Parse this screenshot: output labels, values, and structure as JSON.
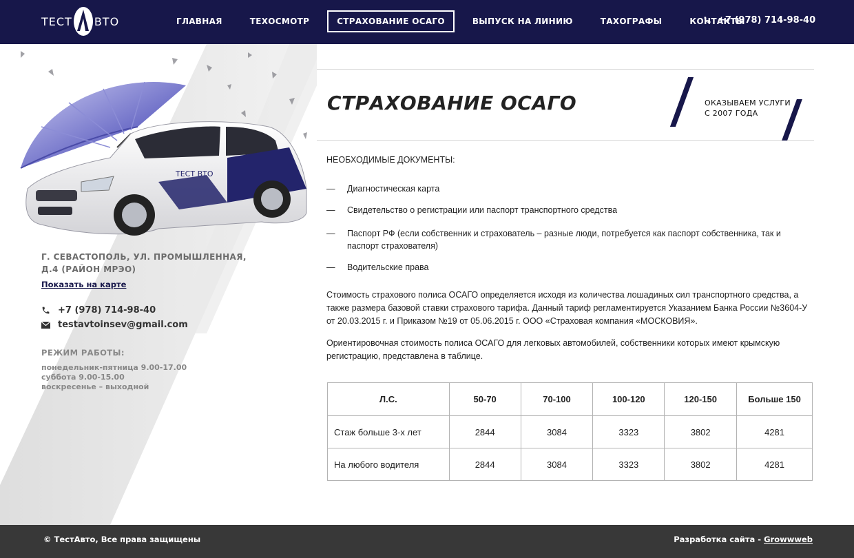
{
  "header": {
    "logo_left": "ТЕСТ",
    "logo_right": "ВТО",
    "nav": [
      {
        "label": "ГЛАВНАЯ"
      },
      {
        "label": "ТЕХОСМОТР"
      },
      {
        "label": "СТРАХОВАНИЕ ОСАГО"
      },
      {
        "label": "ВЫПУСК НА ЛИНИЮ"
      },
      {
        "label": "ТАХОГРАФЫ"
      },
      {
        "label": "КОНТАКТЫ"
      }
    ],
    "active_nav": "СТРАХОВАНИЕ ОСАГО",
    "phone": "+7 (978) 714-98-40"
  },
  "sidebar": {
    "hero_car_logo": "ТЕСТ ВТО",
    "address_line1": "г. Севастополь, ул. Промышленная,",
    "address_line2": "д.4 (район МРЭО)",
    "map_link": "Показать на карте",
    "phone": "+7 (978) 714-98-40",
    "email": "testavtoinsev@gmail.com",
    "hours_title": "РЕЖИМ РАБОТЫ:",
    "hours": [
      "понедельник-пятница 9.00-17.00",
      "суббота 9.00-15.00",
      "воскресенье – выходной"
    ]
  },
  "main": {
    "title": "СТРАХОВАНИЕ ОСАГО",
    "since_line1": "ОКАЗЫВАЕМ УСЛУГИ",
    "since_line2": "С 2007 ГОДА",
    "docs_title": "НЕОБХОДИМЫЕ ДОКУМЕНТЫ:",
    "dash": "—",
    "docs": [
      "Диагностическая карта",
      "Свидетельство о регистрации или паспорт транспортного средства",
      "Паспорт РФ (если собственник и страхователь – разные люди, потребуется как паспорт собственника, так и паспорт страхователя)",
      "Водительские права"
    ],
    "paragraph1": "Стоимость страхового полиса ОСАГО определяется исходя из количества лошадиных сил транспортного средства, а также размера базовой ставки страхового тарифа. Данный тариф регламентируется Указанием Банка России №3604-У от 20.03.2015 г. и Приказом №19 от 05.06.2015 г. ООО «Страховая компания «МОСКОВИЯ».",
    "paragraph2": "Ориентировочная стоимость полиса ОСАГО для легковых автомобилей, собственники которых имеют крымскую регистрацию, представлена в таблице.",
    "table": {
      "headers": [
        "Л.С.",
        "50-70",
        "70-100",
        "100-120",
        "120-150",
        "Больше 150"
      ],
      "rows": [
        [
          "Стаж больше 3-х лет",
          "2844",
          "3084",
          "3323",
          "3802",
          "4281"
        ],
        [
          "На любого водителя",
          "2844",
          "3084",
          "3323",
          "3802",
          "4281"
        ]
      ]
    }
  },
  "footer": {
    "copyright": "© ТестАвто, Все права защищены",
    "dev_label": "Разработка сайта - ",
    "dev_link": "Growwweb"
  },
  "colors": {
    "brand_navy": "#17174a",
    "footer_bg": "#383838",
    "table_border": "#b3b3b3"
  },
  "icons": [
    "logo-a-icon",
    "phone-icon",
    "email-icon"
  ]
}
